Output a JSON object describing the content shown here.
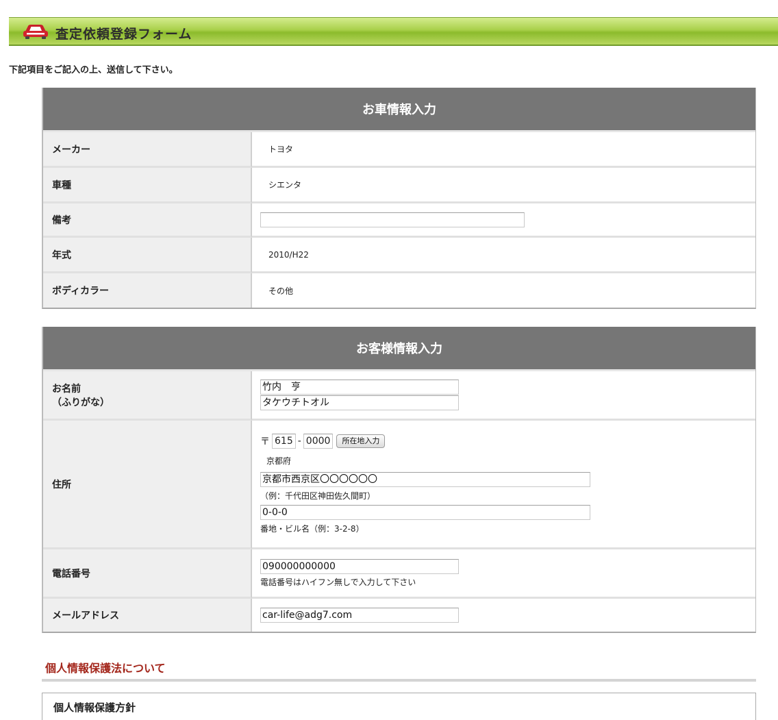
{
  "header": {
    "title": "査定依頼登録フォーム",
    "icon": "car-icon"
  },
  "intro": "下記項目をご記入の上、送信して下さい。",
  "car_section": {
    "heading": "お車情報入力",
    "rows": [
      {
        "label": "メーカー",
        "value": "トヨタ"
      },
      {
        "label": "車種",
        "value": "シエンタ"
      },
      {
        "label": "備考",
        "value": ""
      },
      {
        "label": "年式",
        "value": "2010/H22"
      },
      {
        "label": "ボディカラー",
        "value": "その他"
      }
    ]
  },
  "customer_section": {
    "heading": "お客様情報入力",
    "name": {
      "label_line1": "お名前",
      "label_line2": "（ふりがな）",
      "name_value": "竹内　亨",
      "kana_value": "タケウチトオル"
    },
    "address": {
      "label": "住所",
      "postal_mark": "〒",
      "zip1": "615",
      "separator": "-",
      "zip2": "0000",
      "lookup_button": "所在地入力",
      "prefecture": "京都府",
      "city_value": "京都市西京区〇〇〇〇〇〇",
      "city_hint": "（例：千代田区神田佐久間町）",
      "street_value": "0-0-0",
      "street_hint": "番地・ビル名（例：3-2-8）"
    },
    "phone": {
      "label": "電話番号",
      "value": "090000000000",
      "hint": "電話番号はハイフン無しで入力して下さい"
    },
    "email": {
      "label": "メールアドレス",
      "value": "car-life@adg7.com"
    }
  },
  "privacy": {
    "title": "個人情報保護法について",
    "box_title": "個人情報保護方針"
  },
  "colors": {
    "header_green": "#a9d04a",
    "table_head": "#767676",
    "privacy_red": "#a3261b"
  }
}
